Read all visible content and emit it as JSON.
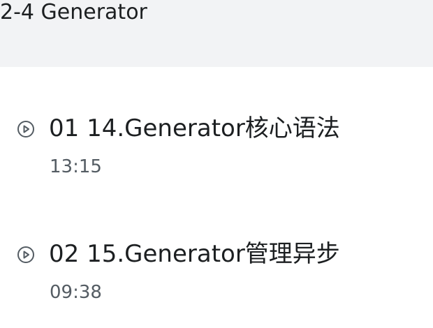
{
  "chapter": {
    "title": "2-4 Generator"
  },
  "lessons": [
    {
      "title": "01 14.Generator核心语法",
      "duration": "13:15",
      "icon": "play-circle-icon"
    },
    {
      "title": "02 15.Generator管理异步",
      "duration": "09:38",
      "icon": "play-circle-icon"
    }
  ],
  "colors": {
    "header_bg": "#f2f3f5",
    "text_primary": "#1c1f21",
    "text_secondary": "#545c63"
  }
}
